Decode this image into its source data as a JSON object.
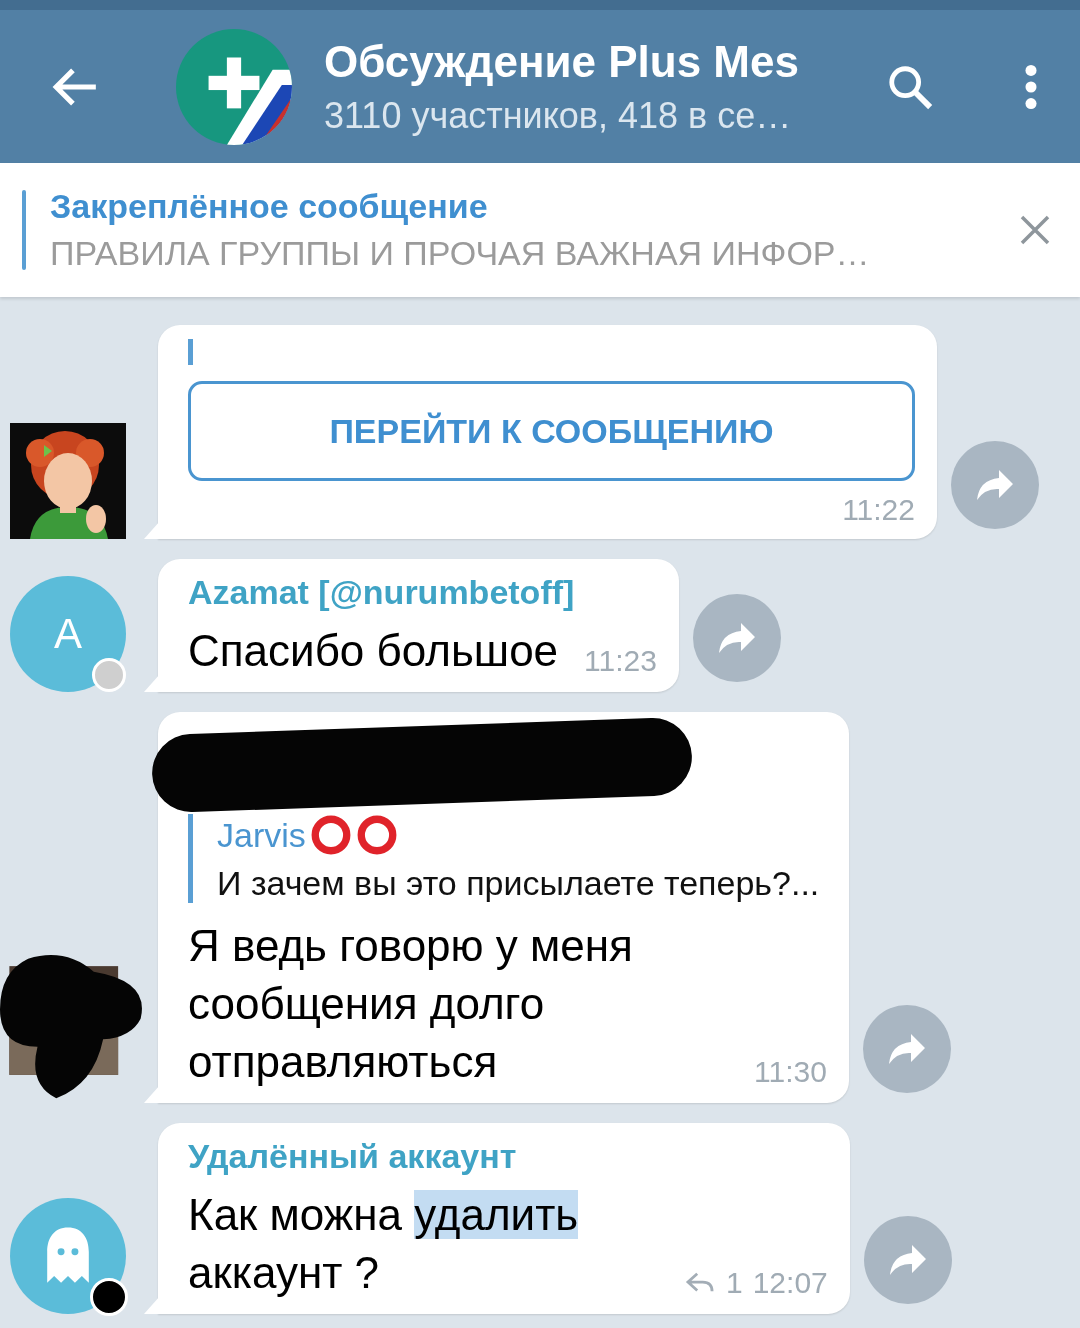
{
  "header": {
    "title": "Обсуждение Plus Mes",
    "subtitle": "3110 участников, 418 в се…"
  },
  "pinned": {
    "label": "Закреплённое сообщение",
    "text": "ПРАВИЛА ГРУППЫ И ПРОЧАЯ ВАЖНАЯ ИНФОР…"
  },
  "messages": [
    {
      "kind": "button",
      "button": "ПЕРЕЙТИ К СООБЩЕНИЮ",
      "time": "11:22"
    },
    {
      "kind": "text",
      "avatar": {
        "kind": "letter",
        "letter": "А",
        "color": "#cfcfcf"
      },
      "sender": "Azamat [@nurumbetoff]",
      "text": [
        {
          "text": "Спасибо большое",
          "selected": false
        }
      ],
      "time": "11:23"
    },
    {
      "kind": "reply",
      "avatar": {
        "kind": "hidden"
      },
      "reply": {
        "name": "Jarvis",
        "text": "И зачем вы это присылаете теперь?..."
      },
      "text": [
        {
          "text": "Я ведь говорю у меня сообщения долго отправляються",
          "selected": false
        }
      ],
      "time": "11:30"
    },
    {
      "kind": "text",
      "avatar": {
        "kind": "ghost",
        "color": "#000000"
      },
      "sender": "Удалённый аккаунт",
      "text": [
        {
          "text": "Как можна ",
          "selected": false
        },
        {
          "text": "удалить",
          "selected": true
        },
        {
          "text": " аккаунт ?",
          "selected": false
        }
      ],
      "replies": "1",
      "time": "12:07"
    }
  ]
}
